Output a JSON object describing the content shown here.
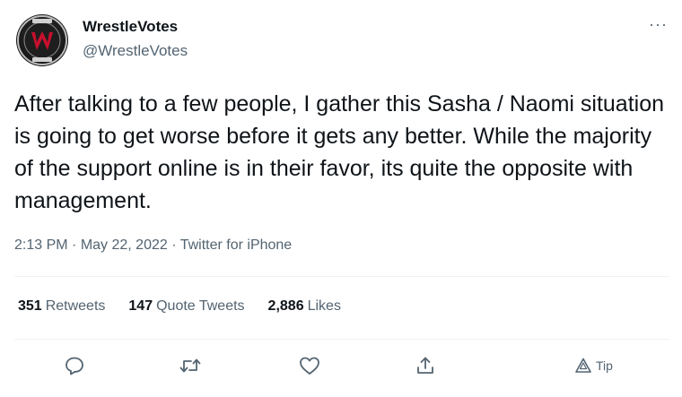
{
  "author": {
    "display_name": "WrestleVotes",
    "handle": "@WrestleVotes",
    "avatar_logo_text": "WRESTLEVOTES"
  },
  "more_icon": "ellipsis-icon",
  "tweet_text": "After talking to a few people, I gather this Sasha / Naomi situation is going to get worse before it gets any better. While the majority of the support online is in their favor, its quite the opposite with management.",
  "meta": {
    "time": "2:13 PM",
    "separator": " · ",
    "date": "May 22, 2022",
    "source": "Twitter for iPhone"
  },
  "stats": {
    "retweets_count": "351",
    "retweets_label": "Retweets",
    "quotes_count": "147",
    "quotes_label": "Quote Tweets",
    "likes_count": "2,886",
    "likes_label": "Likes"
  },
  "actions": {
    "reply_icon": "reply-icon",
    "retweet_icon": "retweet-icon",
    "like_icon": "heart-icon",
    "share_icon": "share-icon",
    "tip_icon": "tip-icon",
    "tip_label": "Tip"
  },
  "colors": {
    "primary_text": "#0f1419",
    "secondary_text": "#536471",
    "divider": "#eff3f4",
    "logo_red": "#c8102e"
  }
}
